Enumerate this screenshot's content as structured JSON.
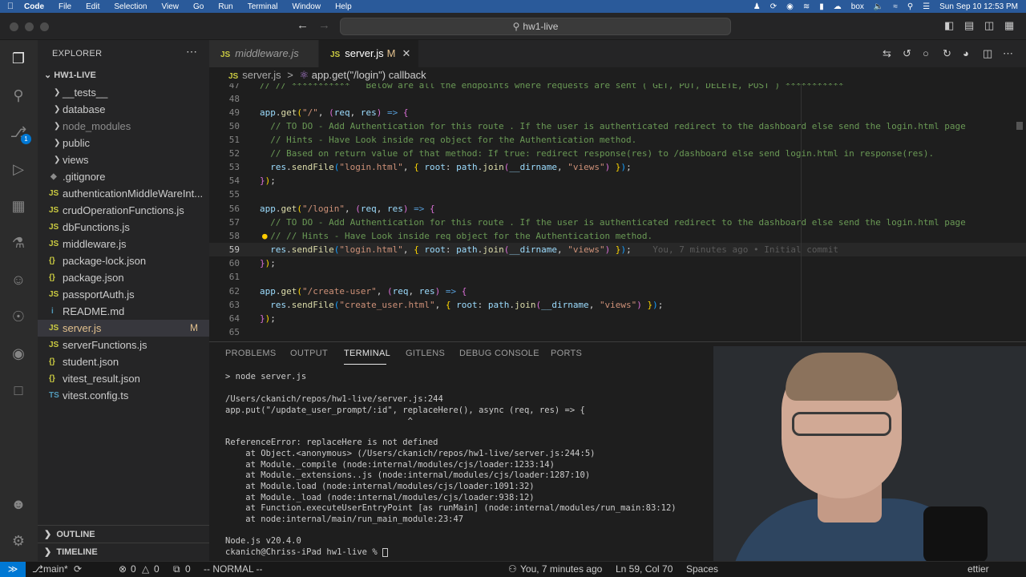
{
  "menubar": {
    "app": "Code",
    "items": [
      "File",
      "Edit",
      "Selection",
      "View",
      "Go",
      "Run",
      "Terminal",
      "Window",
      "Help"
    ],
    "clock": "Sun Sep 10  12:53 PM",
    "box_label": "box"
  },
  "titlebar": {
    "search_text": "hw1-live"
  },
  "sidebar": {
    "title": "EXPLORER",
    "workspace": "HW1-LIVE",
    "items": [
      {
        "type": "folder",
        "name": "__tests__"
      },
      {
        "type": "folder",
        "name": "database"
      },
      {
        "type": "folder",
        "name": "node_modules"
      },
      {
        "type": "folder",
        "name": "public"
      },
      {
        "type": "folder",
        "name": "views"
      },
      {
        "type": "file",
        "icon": "git",
        "name": ".gitignore"
      },
      {
        "type": "file",
        "icon": "JS",
        "name": "authenticationMiddleWareInt..."
      },
      {
        "type": "file",
        "icon": "JS",
        "name": "crudOperationFunctions.js"
      },
      {
        "type": "file",
        "icon": "JS",
        "name": "dbFunctions.js"
      },
      {
        "type": "file",
        "icon": "JS",
        "name": "middleware.js"
      },
      {
        "type": "file",
        "icon": "{}",
        "name": "package-lock.json"
      },
      {
        "type": "file",
        "icon": "{}",
        "name": "package.json"
      },
      {
        "type": "file",
        "icon": "JS",
        "name": "passportAuth.js"
      },
      {
        "type": "file",
        "icon": "i",
        "name": "README.md"
      },
      {
        "type": "file",
        "icon": "JS",
        "name": "server.js",
        "flag": "M"
      },
      {
        "type": "file",
        "icon": "JS",
        "name": "serverFunctions.js"
      },
      {
        "type": "file",
        "icon": "{}",
        "name": "student.json"
      },
      {
        "type": "file",
        "icon": "{}",
        "name": "vitest_result.json"
      },
      {
        "type": "file",
        "icon": "TS",
        "name": "vitest.config.ts"
      }
    ],
    "outline": "OUTLINE",
    "timeline": "TIMELINE"
  },
  "tabs": [
    {
      "icon": "JS",
      "label": "middleware.js"
    },
    {
      "icon": "JS",
      "label": "server.js",
      "flag": "M"
    }
  ],
  "breadcrumb": {
    "file": "server.js",
    "sep": ">",
    "symbol": "app.get(\"/login\") callback"
  },
  "editor": {
    "line47": "// // ***********   Below are all the endpoints where requests are sent ( GET, PUT, DELETE, POST ) ***********",
    "blame": "You, 7 minutes ago • Initial commit",
    "line_numbers": [
      "47",
      "48",
      "49",
      "50",
      "51",
      "52",
      "53",
      "54",
      "55",
      "56",
      "57",
      "58",
      "59",
      "60",
      "61",
      "62",
      "63",
      "64",
      "65"
    ]
  },
  "panel": {
    "tabs": [
      "PROBLEMS",
      "OUTPUT",
      "TERMINAL",
      "GITLENS",
      "DEBUG CONSOLE",
      "PORTS"
    ],
    "shell": "zsh",
    "terminal": [
      "> node server.js",
      "",
      "/Users/ckanich/repos/hw1-live/server.js:244",
      "app.put(\"/update_user_prompt/:id\", replaceHere(), async (req, res) => {",
      "                                    ^",
      "",
      "ReferenceError: replaceHere is not defined",
      "    at Object.<anonymous> (/Users/ckanich/repos/hw1-live/server.js:244:5)",
      "    at Module._compile (node:internal/modules/cjs/loader:1233:14)",
      "    at Module._extensions..js (node:internal/modules/cjs/loader:1287:10)",
      "    at Module.load (node:internal/modules/cjs/loader:1091:32)",
      "    at Module._load (node:internal/modules/cjs/loader:938:12)",
      "    at Function.executeUserEntryPoint [as runMain] (node:internal/modules/run_main:83:12)",
      "    at node:internal/main/run_main_module:23:47",
      "",
      "Node.js v20.4.0",
      "ckanich@Chriss-iPad hw1-live % "
    ]
  },
  "statusbar": {
    "branch": "main*",
    "errors": "0",
    "warnings": "0",
    "ports": "0",
    "mode": "-- NORMAL --",
    "blame": "You, 7 minutes ago",
    "position": "Ln 59, Col 70",
    "spaces": "Spaces",
    "prettier": "ettier"
  },
  "colors": {
    "accent": "#0078d4",
    "modified": "#e2c08d",
    "js_icon": "#cbcb41"
  }
}
